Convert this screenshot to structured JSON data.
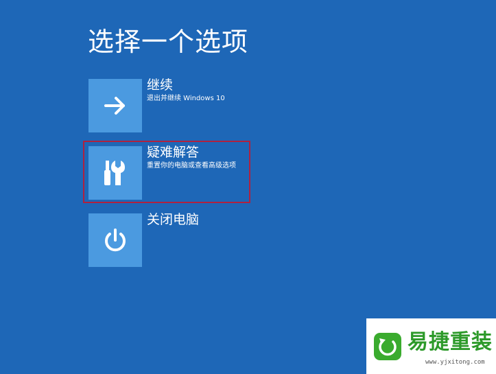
{
  "page": {
    "title": "选择一个选项"
  },
  "options": [
    {
      "icon": "arrow-right-icon",
      "label": "继续",
      "description": "退出并继续 Windows 10"
    },
    {
      "icon": "tools-icon",
      "label": "疑难解答",
      "description": "重置你的电脑或查看高级选项"
    },
    {
      "icon": "power-icon",
      "label": "关闭电脑",
      "description": ""
    }
  ],
  "highlight": {
    "target": "疑难解答",
    "color": "#b0213f"
  },
  "watermark": {
    "name": "易捷重装",
    "url": "www.yjxitong.com",
    "color": "#2d9a2a"
  },
  "colors": {
    "background": "#1e67b7",
    "tile": "#4b9ae0",
    "text": "#ffffff"
  }
}
